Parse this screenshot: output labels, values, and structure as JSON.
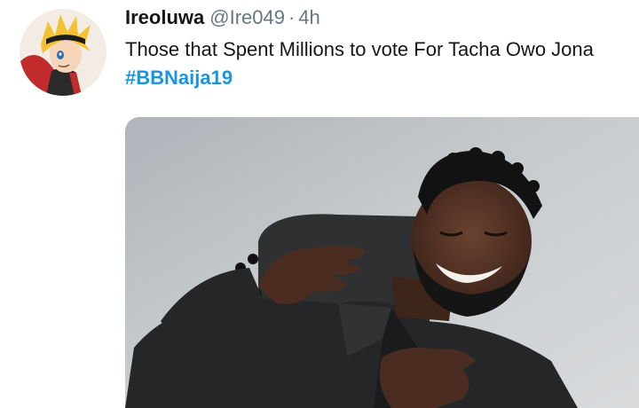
{
  "tweet": {
    "author_name": "Ireoluwa",
    "handle": "@Ire049",
    "separator": "·",
    "time": "4h",
    "text": "Those that Spent Millions to vote For Tacha Owo Jona ",
    "hashtag": "#BBNaija19"
  },
  "colors": {
    "text": "#14171a",
    "secondary": "#657786",
    "link": "#1b95e0"
  },
  "icons": {
    "avatar": "anime-character-avatar",
    "media": "laughing-man-photo"
  }
}
